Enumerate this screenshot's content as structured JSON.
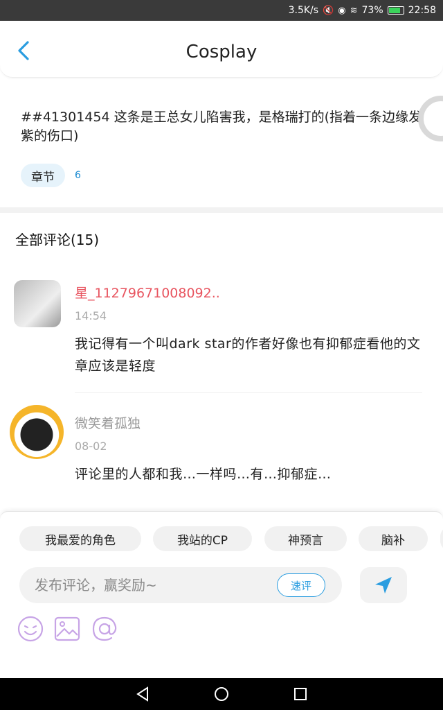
{
  "status_bar": {
    "speed": "3.5K/s",
    "battery": "73%",
    "time": "22:58"
  },
  "header": {
    "title": "Cosplay"
  },
  "post": {
    "text": "##41301454 这条是王总女儿陷害我，是格瑞打的(指着一条边缘发紫的伤口)",
    "chapter_tag": "章节",
    "chapter_count": "6"
  },
  "comments_header": "全部评论(15)",
  "comments": [
    {
      "user": "星_11279671008092..",
      "time": "14:54",
      "text": "我记得有一个叫dark star的作者好像也有抑郁症看他的文章应该是轻度",
      "name_color": "#e8545f"
    },
    {
      "user": "微笑着孤独",
      "time": "08-02",
      "text": "评论里的人都和我…一样吗…有…抑郁症…",
      "name_color": "#999999"
    }
  ],
  "quick_chips": [
    "我最爱的角色",
    "我站的CP",
    "神预言",
    "脑补"
  ],
  "input": {
    "placeholder": "发布评论，赢奖励~",
    "quick_label": "速评"
  },
  "tools": [
    "emoji-icon",
    "image-icon",
    "mention-icon"
  ],
  "colors": {
    "accent": "#2a9de0",
    "tool_purple": "#c7a4e6"
  }
}
